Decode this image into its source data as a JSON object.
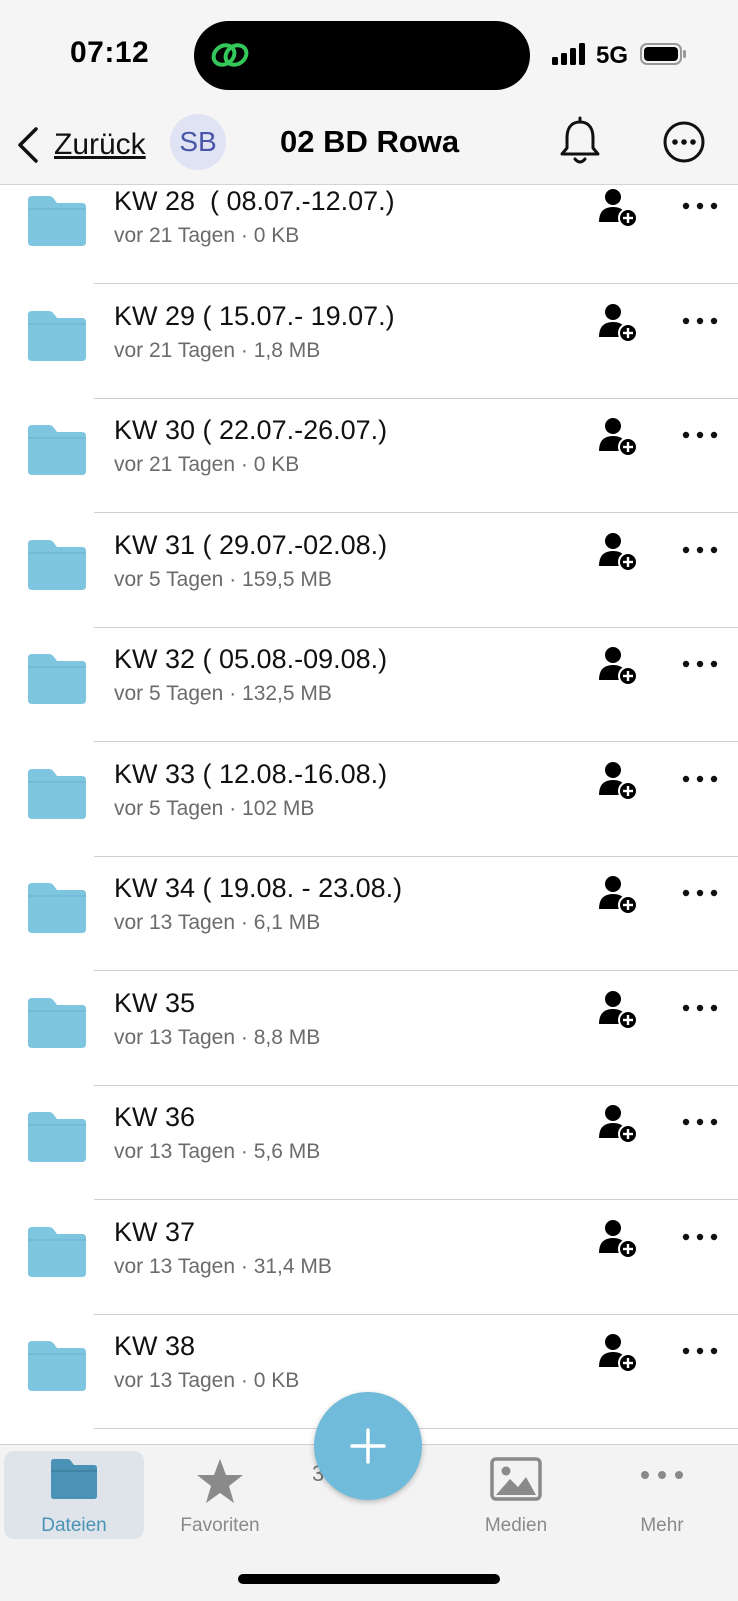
{
  "status_bar": {
    "time": "07:12",
    "network": "5G",
    "signal_icon": "cellular-signal-icon",
    "battery_icon": "battery-icon",
    "dynamic_island_icon": "chain-link-icon",
    "dynamic_island_icon_color": "#34c759"
  },
  "header": {
    "back_label": "Zurück",
    "avatar_initials": "SB",
    "title": "02 BD Rowa",
    "icons": [
      "chevron-left-icon",
      "bell-icon",
      "more-circle-icon"
    ]
  },
  "folders": [
    {
      "title": "KW 28  ( 08.07.-12.07.)",
      "subtitle": "vor 21 Tagen · 0 KB"
    },
    {
      "title": "KW 29 ( 15.07.- 19.07.)",
      "subtitle": "vor 21 Tagen · 1,8 MB"
    },
    {
      "title": "KW 30 ( 22.07.-26.07.)",
      "subtitle": "vor 21 Tagen · 0 KB"
    },
    {
      "title": "KW 31 ( 29.07.-02.08.)",
      "subtitle": "vor 5 Tagen · 159,5 MB"
    },
    {
      "title": "KW 32 ( 05.08.-09.08.)",
      "subtitle": "vor 5 Tagen · 132,5 MB"
    },
    {
      "title": "KW 33 ( 12.08.-16.08.)",
      "subtitle": "vor 5 Tagen · 102 MB"
    },
    {
      "title": "KW 34 ( 19.08. - 23.08.)",
      "subtitle": "vor 13 Tagen · 6,1 MB"
    },
    {
      "title": "KW 35",
      "subtitle": "vor 13 Tagen · 8,8 MB"
    },
    {
      "title": "KW 36",
      "subtitle": "vor 13 Tagen · 5,6 MB"
    },
    {
      "title": "KW 37",
      "subtitle": "vor 13 Tagen · 31,4 MB"
    },
    {
      "title": "KW 38",
      "subtitle": "vor 13 Tagen · 0 KB"
    }
  ],
  "row_icons": [
    "folder-icon",
    "share-person-add-icon",
    "more-horizontal-icon"
  ],
  "folder_color": "#7ec6e0",
  "footer_count": "3          er",
  "fab_icon": "plus-icon",
  "fab_color": "#6fbbd9",
  "tabs": [
    {
      "label": "Dateien",
      "icon": "folder-icon",
      "active": true
    },
    {
      "label": "Favoriten",
      "icon": "star-icon",
      "active": false
    },
    {
      "label": "Medien",
      "icon": "image-icon",
      "active": false
    },
    {
      "label": "Mehr",
      "icon": "more-horizontal-icon",
      "active": false
    }
  ],
  "accent_color": "#4a93b6"
}
